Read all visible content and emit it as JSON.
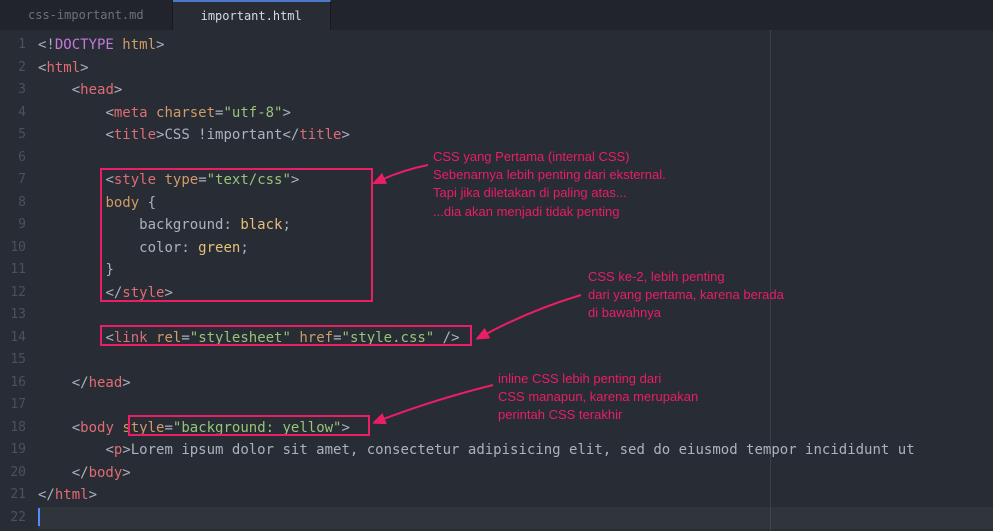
{
  "tabs": [
    {
      "label": "css-important.md",
      "active": false
    },
    {
      "label": "important.html",
      "active": true
    }
  ],
  "lineCount": 22,
  "code": {
    "l1": {
      "a": "<!",
      "b": "DOCTYPE",
      "c": " html",
      "d": ">"
    },
    "l2": {
      "a": "<",
      "b": "html",
      "c": ">"
    },
    "l3": {
      "a": "<",
      "b": "head",
      "c": ">"
    },
    "l4": {
      "a": "<",
      "b": "meta",
      "c": "charset",
      "d": "=",
      "e": "\"utf-8\"",
      "f": ">"
    },
    "l5": {
      "a": "<",
      "b": "title",
      "c": ">",
      "d": "CSS !important",
      "e": "</",
      "f": "title",
      "g": ">"
    },
    "l7": {
      "a": "<",
      "b": "style",
      "c": "type",
      "d": "=",
      "e": "\"text/css\"",
      "f": ">"
    },
    "l8": {
      "a": "body",
      "b": " {"
    },
    "l9": {
      "a": "background",
      "b": ": ",
      "c": "black",
      "d": ";"
    },
    "l10": {
      "a": "color",
      "b": ": ",
      "c": "green",
      "d": ";"
    },
    "l11": {
      "a": "}"
    },
    "l12": {
      "a": "</",
      "b": "style",
      "c": ">"
    },
    "l14": {
      "a": "<",
      "b": "link",
      "c": "rel",
      "d": "=",
      "e": "\"stylesheet\"",
      "f": "href",
      "g": "=",
      "h": "\"style.css\"",
      "i": " />"
    },
    "l16": {
      "a": "</",
      "b": "head",
      "c": ">"
    },
    "l18": {
      "a": "<",
      "b": "body",
      "c": "style",
      "d": "=",
      "e": "\"background: yellow\"",
      "f": ">"
    },
    "l19": {
      "a": "<",
      "b": "p",
      "c": ">",
      "d": "Lorem ipsum dolor sit amet, consectetur adipisicing elit, sed do eiusmod tempor incididunt ut "
    },
    "l20": {
      "a": "</",
      "b": "body",
      "c": ">"
    },
    "l21": {
      "a": "</",
      "b": "html",
      "c": ">"
    }
  },
  "annotations": {
    "a1": {
      "l1": "CSS yang Pertama (internal CSS)",
      "l2": "Sebenarnya lebih penting dari eksternal.",
      "l3": "Tapi jika diletakan di paling atas...",
      "l4": "...dia akan menjadi tidak penting"
    },
    "a2": {
      "l1": "CSS ke-2, lebih penting",
      "l2": "dari yang pertama, karena berada",
      "l3": "di bawahnya"
    },
    "a3": {
      "l1": "inline CSS lebih penting dari",
      "l2": "CSS manapun, karena merupakan",
      "l3": "perintah CSS terakhir"
    }
  }
}
